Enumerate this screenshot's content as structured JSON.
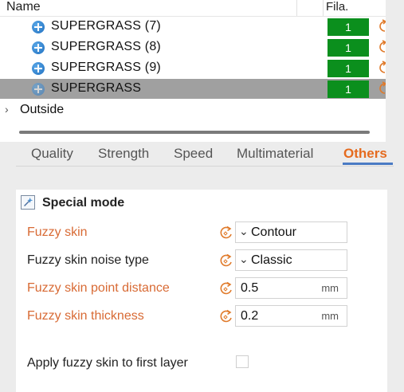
{
  "object_list": {
    "header": {
      "name": "Name",
      "filament": "Fila."
    },
    "rows": [
      {
        "label": "SUPERGRASS (7)",
        "filament": "1",
        "selected": false
      },
      {
        "label": "SUPERGRASS (8)",
        "filament": "1",
        "selected": false
      },
      {
        "label": "SUPERGRASS (9)",
        "filament": "1",
        "selected": false
      },
      {
        "label": "SUPERGRASS",
        "filament": "1",
        "selected": true
      }
    ],
    "outside_label": "Outside",
    "filament_color": "#0b8f1d"
  },
  "tabs": [
    {
      "label": "Quality",
      "active": false
    },
    {
      "label": "Strength",
      "active": false
    },
    {
      "label": "Speed",
      "active": false
    },
    {
      "label": "Multimaterial",
      "active": false
    },
    {
      "label": "Others",
      "active": true
    }
  ],
  "section": {
    "title": "Special mode",
    "icon": "wand-icon"
  },
  "options": {
    "fuzzy_skin": {
      "label": "Fuzzy skin",
      "value": "Contour",
      "changed": true
    },
    "noise_type": {
      "label": "Fuzzy skin noise type",
      "value": "Classic",
      "changed": false
    },
    "point_distance": {
      "label": "Fuzzy skin point distance",
      "value": "0.5",
      "unit": "mm",
      "changed": true
    },
    "thickness": {
      "label": "Fuzzy skin thickness",
      "value": "0.2",
      "unit": "mm",
      "changed": true
    },
    "first_layer": {
      "label": "Apply fuzzy skin to first layer",
      "checked": false
    }
  },
  "colors": {
    "accent": "#e56b1f",
    "changed_label": "#d86a34",
    "tab_underline": "#4a7bc4",
    "selected_row": "#a0a0a0"
  }
}
